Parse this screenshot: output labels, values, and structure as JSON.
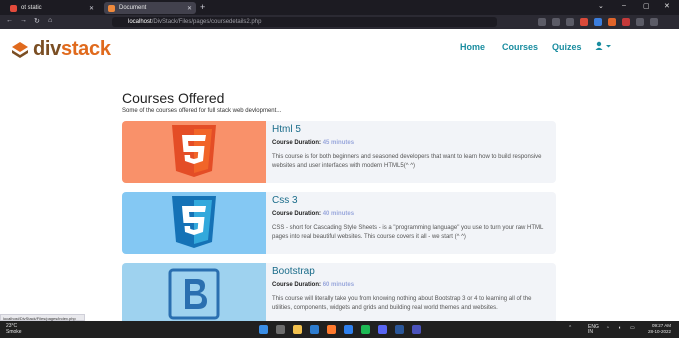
{
  "browser": {
    "tabs": [
      {
        "label": "ot static",
        "color": "#e24a3b"
      },
      {
        "label": "Document",
        "color": "#f08a3c"
      }
    ],
    "new_tab_label": "+",
    "url_host": "localhost",
    "url_path": "/DivStack/Files/pages/coursedetails2.php",
    "window_controls": [
      "⌄",
      "–",
      "▢",
      "✕"
    ],
    "nav_buttons": [
      "←",
      "→",
      "↻",
      "⌂"
    ]
  },
  "site": {
    "logo_div": "div",
    "logo_stack": "stack",
    "nav": [
      "Home",
      "Courses",
      "Quizes"
    ],
    "user_icon": "user-icon"
  },
  "page": {
    "title": "Courses Offered",
    "subtitle": "Some of the courses offered for full stack web devlopment..."
  },
  "courses": [
    {
      "title": "Html 5",
      "duration_label": "Course Duration:",
      "duration_value": "45 minutes",
      "description": "This course is for both beginners and seasoned developers that want to learn how to build responsive websites and user interfaces with modern HTML5(^ ^)",
      "bg": "#f9916a",
      "icon": "html5-icon"
    },
    {
      "title": "Css 3",
      "duration_label": "Course Duration:",
      "duration_value": "40 minutes",
      "description": "CSS - short for Cascading Style Sheets - is a \"programming language\" you use to turn your raw HTML pages into real beautiful websites. This course covers it all - we start (^ ^)",
      "bg": "#84c8f3",
      "icon": "css3-icon"
    },
    {
      "title": "Bootstrap",
      "duration_label": "Course Duration:",
      "duration_value": "60 minutes",
      "description": "This course will literally take you from knowing nothing about Bootstrap 3 or 4 to learning all of the utilities, components, widgets and grids and building real world themes and websites.",
      "bg": "#9ed2ef",
      "icon": "bootstrap-icon"
    }
  ],
  "status_bar": "localhost/DivStack/Files/pages/index.php",
  "taskbar": {
    "weather_temp": "23°C",
    "weather_desc": "Smoke",
    "lang": "ENG",
    "region": "IN",
    "time": "09:27 AM",
    "date": "28-10-2022"
  }
}
